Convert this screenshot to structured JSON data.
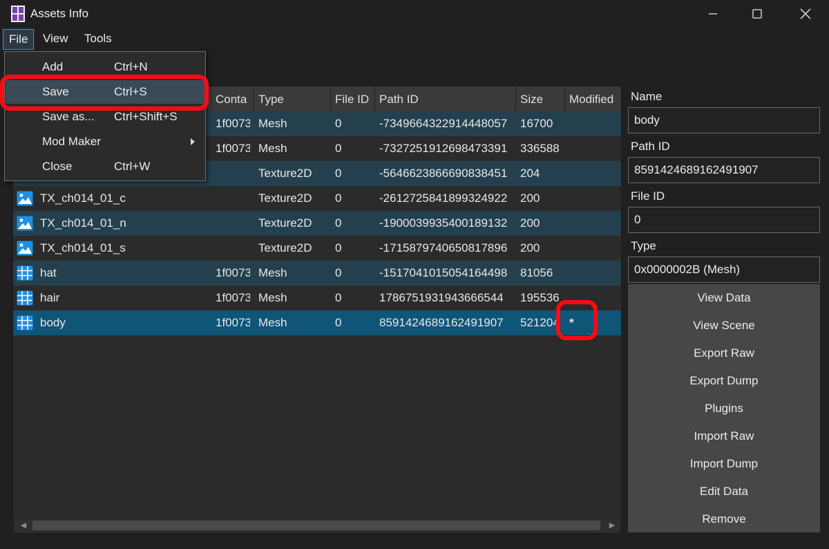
{
  "window": {
    "title": "Assets Info"
  },
  "menu": {
    "file": "File",
    "view": "View",
    "tools": "Tools"
  },
  "file_menu": {
    "items": [
      {
        "label": "Add",
        "shortcut": "Ctrl+N"
      },
      {
        "label": "Save",
        "shortcut": "Ctrl+S"
      },
      {
        "label": "Save as...",
        "shortcut": "Ctrl+Shift+S"
      },
      {
        "label": "Mod Maker",
        "shortcut": ""
      },
      {
        "label": "Close",
        "shortcut": "Ctrl+W"
      }
    ]
  },
  "table": {
    "columns": [
      "Conta",
      "Type",
      "File ID",
      "Path ID",
      "Size",
      "Modified"
    ],
    "rows": [
      {
        "name": "",
        "container": "1f0073",
        "type": "Mesh",
        "file_id": "0",
        "path_id": "-7349664322914448057",
        "size": "16700",
        "modified": "",
        "icon": "mesh-icon"
      },
      {
        "name": "",
        "container": "1f0073",
        "type": "Mesh",
        "file_id": "0",
        "path_id": "-7327251912698473391",
        "size": "336588",
        "modified": "",
        "icon": "mesh-icon"
      },
      {
        "name": "",
        "container": "",
        "type": "Texture2D",
        "file_id": "0",
        "path_id": "-5646623866690838451",
        "size": "204",
        "modified": "",
        "icon": "texture-icon"
      },
      {
        "name": "TX_ch014_01_c",
        "container": "",
        "type": "Texture2D",
        "file_id": "0",
        "path_id": "-2612725841899324922",
        "size": "200",
        "modified": "",
        "icon": "texture-icon"
      },
      {
        "name": "TX_ch014_01_n",
        "container": "",
        "type": "Texture2D",
        "file_id": "0",
        "path_id": "-1900039935400189132",
        "size": "200",
        "modified": "",
        "icon": "texture-icon"
      },
      {
        "name": "TX_ch014_01_s",
        "container": "",
        "type": "Texture2D",
        "file_id": "0",
        "path_id": "-1715879740650817896",
        "size": "200",
        "modified": "",
        "icon": "texture-icon"
      },
      {
        "name": "hat",
        "container": "1f0073",
        "type": "Mesh",
        "file_id": "0",
        "path_id": "-1517041015054164498",
        "size": "81056",
        "modified": "",
        "icon": "mesh-icon"
      },
      {
        "name": "hair",
        "container": "1f0073",
        "type": "Mesh",
        "file_id": "0",
        "path_id": "1786751931943666544",
        "size": "195536",
        "modified": "",
        "icon": "mesh-icon"
      },
      {
        "name": "body",
        "container": "1f0073",
        "type": "Mesh",
        "file_id": "0",
        "path_id": "8591424689162491907",
        "size": "521204",
        "modified": "*",
        "icon": "mesh-icon"
      }
    ]
  },
  "details": {
    "name_label": "Name",
    "name_value": "body",
    "path_id_label": "Path ID",
    "path_id_value": "8591424689162491907",
    "file_id_label": "File ID",
    "file_id_value": "0",
    "type_label": "Type",
    "type_value": "0x0000002B (Mesh)"
  },
  "actions": [
    "View Data",
    "View Scene",
    "Export Raw",
    "Export Dump",
    "Plugins",
    "Import Raw",
    "Import Dump",
    "Edit Data",
    "Remove"
  ],
  "colors": {
    "accent": "#0f5578",
    "row_alt": "#24404f",
    "annotation": "#ff0a14"
  }
}
